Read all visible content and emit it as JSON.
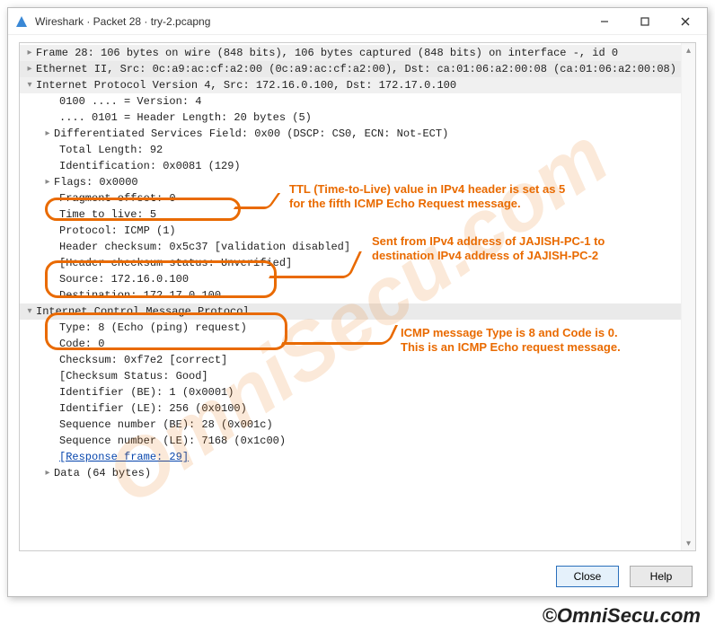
{
  "title": "Wireshark · Packet 28 · try-2.pcapng",
  "tree": {
    "frame": "Frame 28: 106 bytes on wire (848 bits), 106 bytes captured (848 bits) on interface -, id 0",
    "eth": "Ethernet II, Src: 0c:a9:ac:cf:a2:00 (0c:a9:ac:cf:a2:00), Dst: ca:01:06:a2:00:08 (ca:01:06:a2:00:08)",
    "ipv4": "Internet Protocol Version 4, Src: 172.16.0.100, Dst: 172.17.0.100",
    "version": "0100 .... = Version: 4",
    "hdrlen": ".... 0101 = Header Length: 20 bytes (5)",
    "dsf": "Differentiated Services Field: 0x00 (DSCP: CS0, ECN: Not-ECT)",
    "totlen": "Total Length: 92",
    "ident": "Identification: 0x0081 (129)",
    "flags": "Flags: 0x0000",
    "frag": "Fragment offset: 0",
    "ttl": "Time to live: 5",
    "proto": "Protocol: ICMP (1)",
    "hchk": "Header checksum: 0x5c37 [validation disabled]",
    "hchkst": "[Header checksum status: Unverified]",
    "src": "Source: 172.16.0.100",
    "dst": "Destination: 172.17.0.100",
    "icmp": "Internet Control Message Protocol",
    "type": "Type: 8 (Echo (ping) request)",
    "code": "Code: 0",
    "chk": "Checksum: 0xf7e2 [correct]",
    "chkst": "[Checksum Status: Good]",
    "idbe": "Identifier (BE): 1 (0x0001)",
    "idle": "Identifier (LE): 256 (0x0100)",
    "seqbe": "Sequence number (BE): 28 (0x001c)",
    "seqle": "Sequence number (LE): 7168 (0x1c00)",
    "resp": "[Response frame: 29]",
    "data": "Data (64 bytes)"
  },
  "buttons": {
    "close": "Close",
    "help": "Help"
  },
  "annotations": {
    "a1l1": "TTL (Time-to-Live) value in IPv4 header is set as 5",
    "a1l2": "for the  fifth ICMP Echo Request message.",
    "a2l1": "Sent from IPv4 address of JAJISH-PC-1 to",
    "a2l2": "destination IPv4 address of  JAJISH-PC-2",
    "a3l1": "ICMP message Type is 8 and Code is 0.",
    "a3l2": "This is an ICMP Echo request message."
  },
  "watermark": "OmniSecu.com",
  "copyright": "©OmniSecu.com"
}
